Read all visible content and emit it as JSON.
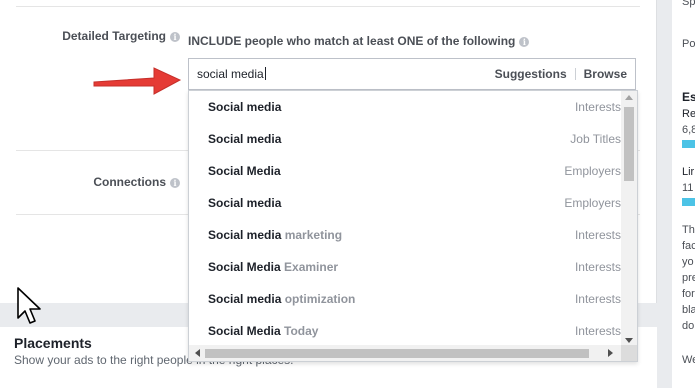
{
  "targeting": {
    "detailed_label": "Detailed Targeting",
    "include_text": "INCLUDE people who match at least ONE of the following",
    "search_value": "social media",
    "suggestions": "Suggestions",
    "browse": "Browse",
    "connections_label": "Connections"
  },
  "options": [
    {
      "bold": "Social media",
      "rest": "",
      "type": "Interests"
    },
    {
      "bold": "Social media",
      "rest": "",
      "type": "Job Titles"
    },
    {
      "bold": "Social Media",
      "rest": "",
      "type": "Employers"
    },
    {
      "bold": "Social media",
      "rest": "",
      "type": "Employers"
    },
    {
      "bold": "Social media",
      "rest": " marketing",
      "type": "Interests"
    },
    {
      "bold": "Social Media",
      "rest": " Examiner",
      "type": "Interests"
    },
    {
      "bold": "Social media",
      "rest": " optimization",
      "type": "Interests"
    },
    {
      "bold": "Social Media",
      "rest": " Today",
      "type": "Interests"
    }
  ],
  "placements": {
    "title": "Placements",
    "subtitle": "Show your ads to the right people in the right places."
  },
  "right_col": {
    "sp": "Sp",
    "po": "Po",
    "es": "Es",
    "re": "Re",
    "re_val": "6,8",
    "li": "Lir",
    "li_val": "11",
    "t1": "Th",
    "t2": "fac",
    "t3": "yo",
    "t4": "pre",
    "t5": "for",
    "t6": "bla",
    "t7": "do",
    "we": "We"
  },
  "colors": {
    "arrow": "#e53b35",
    "bar": "#4cc3e6"
  }
}
